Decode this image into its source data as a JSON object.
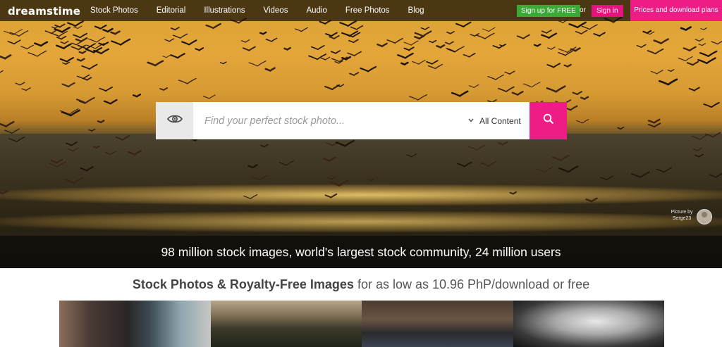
{
  "brand": {
    "logo": "dreamstime"
  },
  "nav": {
    "items": [
      "Stock Photos",
      "Editorial",
      "Illustrations",
      "Videos",
      "Audio",
      "Free Photos",
      "Blog"
    ]
  },
  "auth": {
    "signup_label": "Sign up for FREE",
    "or_label": "or",
    "signin_label": "Sign in",
    "prices_label": "Prices and download plans"
  },
  "search": {
    "placeholder": "Find your perfect stock photo...",
    "value": "",
    "content_filter": "All Content"
  },
  "hero": {
    "caption": "98 million stock images, world's largest stock community, 24 million users",
    "credit_label": "Picture by",
    "credit_author": "Serge23"
  },
  "tagline": {
    "bold": "Stock Photos & Royalty-Free Images",
    "rest": " for as low as 10.96 PhP/download or free"
  },
  "colors": {
    "accent_pink": "#ee1d86",
    "signup_green": "#3aa935"
  },
  "icons": {
    "visual_search": "eye-icon",
    "search": "search-icon",
    "dropdown": "chevron-down-icon"
  }
}
